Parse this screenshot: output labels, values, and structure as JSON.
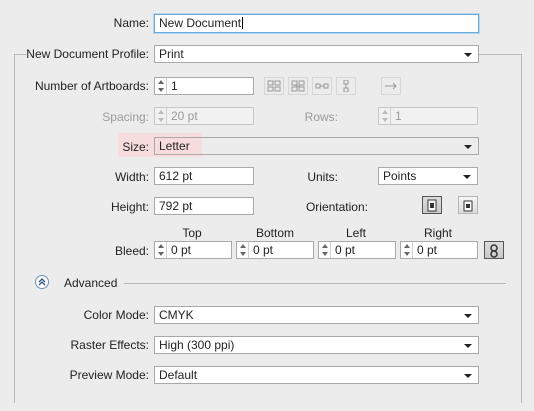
{
  "name_row": {
    "label": "Name:",
    "value": "New Document"
  },
  "profile": {
    "label": "New Document Profile:",
    "value": "Print"
  },
  "artboards": {
    "number_label": "Number of Artboards:",
    "number_value": "1",
    "spacing_label": "Spacing:",
    "spacing_value": "20 pt",
    "rows_label": "Rows:",
    "rows_value": "1",
    "layout_icons": [
      "grid-by-row-icon",
      "grid-by-column-icon",
      "arrange-by-row-icon",
      "arrange-by-column-icon",
      "right-to-left-icon"
    ]
  },
  "size": {
    "label": "Size:",
    "value": "Letter"
  },
  "width": {
    "label": "Width:",
    "value": "612 pt"
  },
  "units": {
    "label": "Units:",
    "value": "Points"
  },
  "height": {
    "label": "Height:",
    "value": "792 pt"
  },
  "orientation": {
    "label": "Orientation:",
    "options": [
      "portrait-icon",
      "landscape-icon"
    ],
    "selected": "portrait"
  },
  "bleed": {
    "label": "Bleed:",
    "top_label": "Top",
    "top_value": "0 pt",
    "bottom_label": "Bottom",
    "bottom_value": "0 pt",
    "left_label": "Left",
    "left_value": "0 pt",
    "right_label": "Right",
    "right_value": "0 pt",
    "link_icon": "chain-link-icon"
  },
  "advanced": {
    "label": "Advanced",
    "color_mode_label": "Color Mode:",
    "color_mode_value": "CMYK",
    "raster_label": "Raster Effects:",
    "raster_value": "High (300 ppi)",
    "preview_label": "Preview Mode:",
    "preview_value": "Default"
  },
  "colors": {
    "background": "#ececec",
    "focus": "#6aa8d8",
    "highlight": "#f6dcdc"
  }
}
